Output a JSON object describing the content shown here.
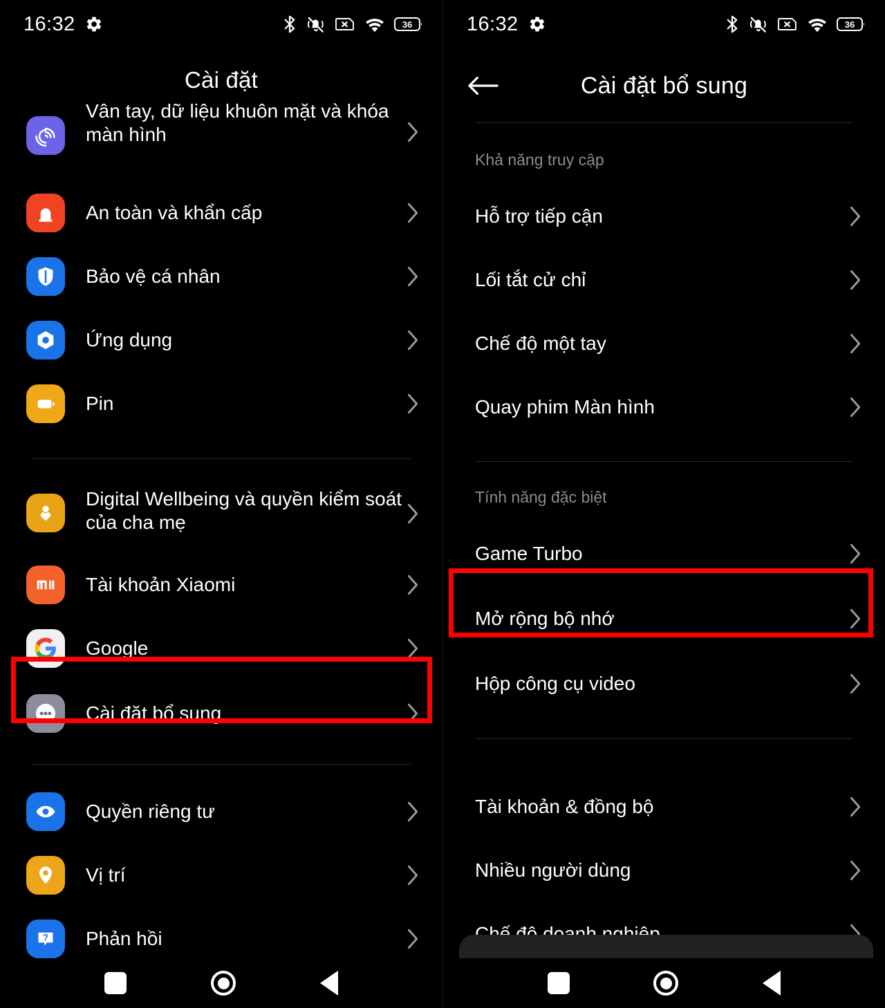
{
  "status_bar": {
    "time": "16:32",
    "icons": [
      "gear-icon",
      "bluetooth-icon",
      "silent-vibrate-icon",
      "sim-card-error-icon",
      "wifi-icon",
      "battery-icon"
    ],
    "battery_level": "36"
  },
  "left_screen": {
    "title": "Cài đặt",
    "groups": [
      {
        "items": [
          {
            "label": "Vân tay, dữ liệu khuôn mặt và khóa màn hình",
            "icon": "fingerprint-icon",
            "icon_color": "#6c63e8",
            "two_line": true,
            "clipped_top": true
          },
          {
            "label": "An toàn và khẩn cấp",
            "icon": "emergency-siren-icon",
            "icon_color": "#ef4323"
          },
          {
            "label": "Bảo vệ cá nhân",
            "icon": "shield-person-icon",
            "icon_color": "#1a73e8"
          },
          {
            "label": "Ứng dụng",
            "icon": "apps-hexagon-icon",
            "icon_color": "#1a73e8"
          },
          {
            "label": "Pin",
            "icon": "battery-app-icon",
            "icon_color": "#f0a818"
          }
        ]
      },
      {
        "items": [
          {
            "label": "Digital Wellbeing và quyền kiểm soát của cha mẹ",
            "icon": "wellbeing-person-icon",
            "icon_color": "#e8a317",
            "two_line": true
          },
          {
            "label": "Tài khoản Xiaomi",
            "icon": "mi-logo-icon",
            "icon_color": "#f4622c"
          },
          {
            "label": "Google",
            "icon": "google-g-icon",
            "icon_color": "#f1f1f1"
          },
          {
            "label": "Cài đặt bổ sung",
            "icon": "more-dots-icon",
            "icon_color": "#8b8c9e",
            "highlighted": true
          }
        ]
      },
      {
        "items": [
          {
            "label": "Quyền riêng tư",
            "icon": "eye-icon",
            "icon_color": "#1a73e8"
          },
          {
            "label": "Vị trí",
            "icon": "location-pin-icon",
            "icon_color": "#eda519"
          },
          {
            "label": "Phản hồi",
            "icon": "feedback-question-icon",
            "icon_color": "#1a73e8"
          }
        ]
      }
    ]
  },
  "right_screen": {
    "title": "Cài đặt bổ sung",
    "back_icon": "arrow-left-icon",
    "sections": [
      {
        "header": "Khả năng truy cập",
        "items": [
          {
            "label": "Hỗ trợ tiếp cận"
          },
          {
            "label": "Lối tắt cử chỉ"
          },
          {
            "label": "Chế độ một tay"
          },
          {
            "label": "Quay phim Màn hình"
          }
        ]
      },
      {
        "header": "Tính năng đặc biệt",
        "items": [
          {
            "label": "Game Turbo"
          },
          {
            "label": "Mở rộng bộ nhớ",
            "highlighted": true
          },
          {
            "label": "Hộp công cụ video"
          }
        ]
      },
      {
        "header": "",
        "items": [
          {
            "label": "Tài khoản & đồng bộ"
          },
          {
            "label": "Nhiều người dùng"
          },
          {
            "label": "Chế độ doanh nghiệp"
          }
        ]
      }
    ]
  },
  "nav_bar": {
    "recents_label": "recents-square-icon",
    "home_label": "home-circle-icon",
    "back_label": "back-triangle-icon"
  },
  "colors": {
    "highlight": "#fe0000",
    "background": "#000000",
    "text": "#ffffff",
    "muted": "#8c8c8c",
    "divider": "#2b2b2b"
  }
}
